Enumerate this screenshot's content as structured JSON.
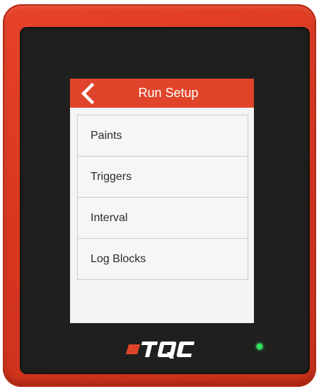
{
  "header": {
    "title": "Run Setup",
    "back_icon": "chevron-left-icon"
  },
  "menu": {
    "items": [
      {
        "label": "Paints"
      },
      {
        "label": "Triggers"
      },
      {
        "label": "Interval"
      },
      {
        "label": "Log Blocks"
      }
    ]
  },
  "device": {
    "brand": "TQC",
    "case_color": "#d9371f",
    "header_color": "#e0442a",
    "status_led_color": "#2ee85a"
  }
}
